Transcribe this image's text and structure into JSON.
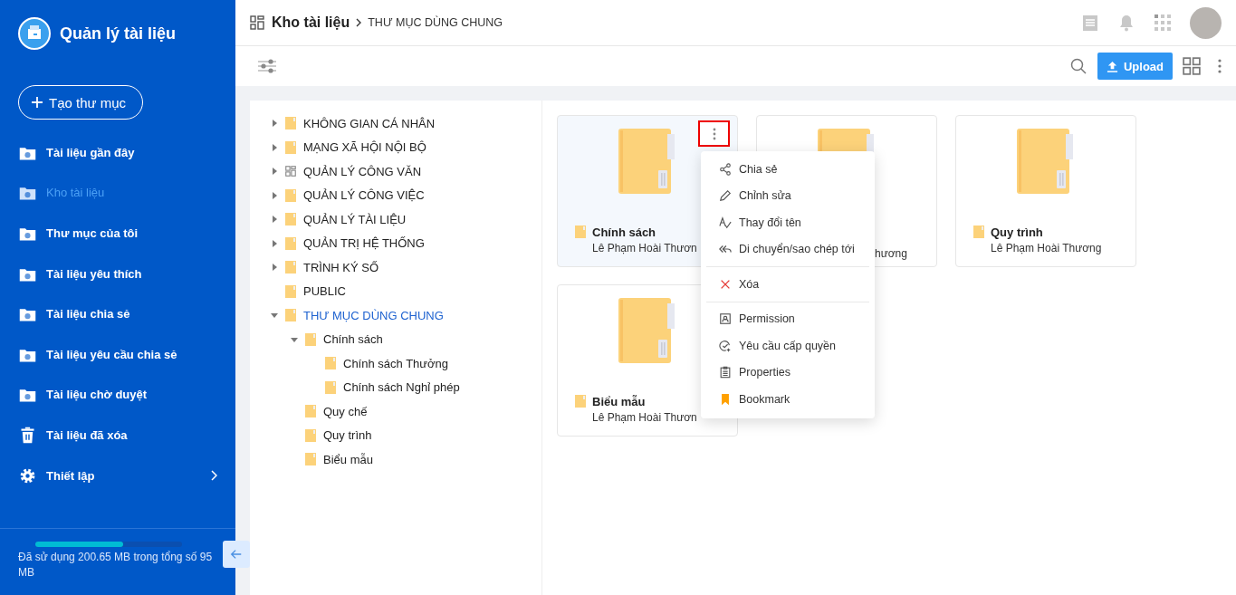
{
  "app": {
    "title": "Quản lý tài liệu",
    "create_button": "Tạo thư mục"
  },
  "sidebar": {
    "items": [
      {
        "label": "Tài liệu gần đây",
        "kind": "link",
        "selected": false
      },
      {
        "label": "Kho tài liệu",
        "kind": "link",
        "selected": true
      },
      {
        "label": "Thư mục của tôi",
        "kind": "link",
        "selected": false
      },
      {
        "label": "Tài liệu yêu thích",
        "kind": "link",
        "selected": false
      },
      {
        "label": "Tài liệu chia sẻ",
        "kind": "link",
        "selected": false
      },
      {
        "label": "Tài liệu yêu cầu chia sẻ",
        "kind": "link",
        "selected": false
      },
      {
        "label": "Tài liệu chờ duyệt",
        "kind": "link",
        "selected": false
      },
      {
        "label": "Tài liệu đã xóa",
        "kind": "link",
        "selected": false
      },
      {
        "label": "Thiết lập",
        "kind": "group",
        "selected": false
      }
    ],
    "storage": {
      "level": 0.6,
      "text": "Đã sử dụng 200.65 MB trong tổng số 95 MB"
    }
  },
  "breadcrumb": {
    "root": "Kho tài liệu",
    "current": "THƯ MỤC DÙNG CHUNG"
  },
  "toolbar": {
    "upload_button": "Upload"
  },
  "tree": [
    {
      "label": "KHÔNG GIAN CÁ NHÂN",
      "kind": "folder",
      "expanded": false,
      "selected": false
    },
    {
      "label": "MẠNG XÃ HỘI NỘI BỘ",
      "kind": "folder",
      "expanded": false,
      "selected": false
    },
    {
      "label": "QUẢN LÝ CÔNG VĂN",
      "kind": "module",
      "expanded": false,
      "selected": false
    },
    {
      "label": "QUẢN LÝ CÔNG VIỆC",
      "kind": "folder",
      "expanded": false,
      "selected": false
    },
    {
      "label": "QUẢN LÝ TÀI LIỆU",
      "kind": "folder",
      "expanded": false,
      "selected": false
    },
    {
      "label": "QUẢN TRỊ HỆ THỐNG",
      "kind": "folder",
      "expanded": false,
      "selected": false
    },
    {
      "label": "TRÌNH KÝ SỐ",
      "kind": "folder",
      "expanded": false,
      "selected": false
    },
    {
      "label": "PUBLIC",
      "kind": "folder",
      "selected": false
    },
    {
      "label": "THƯ MỤC DÙNG CHUNG",
      "kind": "folder",
      "expanded": true,
      "selected": true,
      "children": [
        {
          "label": "Chính sách",
          "kind": "folder",
          "expanded": true,
          "selected": false,
          "children": [
            {
              "label": "Chính sách Thưởng",
              "kind": "folder",
              "selected": false
            },
            {
              "label": "Chính sách Nghỉ phép",
              "kind": "folder",
              "selected": false
            }
          ]
        },
        {
          "label": "Quy chế",
          "kind": "folder",
          "selected": false
        },
        {
          "label": "Quy trình",
          "kind": "folder",
          "selected": false
        },
        {
          "label": "Biểu mẫu",
          "kind": "folder",
          "selected": false
        }
      ]
    }
  ],
  "cards": [
    {
      "kind": "full",
      "name": "Chính sách",
      "owner": "Lê Phạm Hoài Thươn",
      "selected": true
    },
    {
      "kind": "covered",
      "owner": "hương",
      "selected": false
    },
    {
      "kind": "full",
      "name": "Quy trình",
      "owner": "Lê Phạm Hoài Thương",
      "selected": false
    },
    {
      "kind": "full",
      "name": "Biểu mẫu",
      "owner": "Lê Phạm Hoài Thươn",
      "selected": false
    }
  ],
  "context_menu": {
    "groups": [
      [
        "Chia sẻ",
        "Chỉnh sửa",
        "Thay đổi tên",
        "Di chuyển/sao chép tới"
      ],
      [
        "Xóa"
      ],
      [
        "Permission",
        "Yêu cầu cấp quyền",
        "Properties",
        "Bookmark"
      ]
    ]
  }
}
